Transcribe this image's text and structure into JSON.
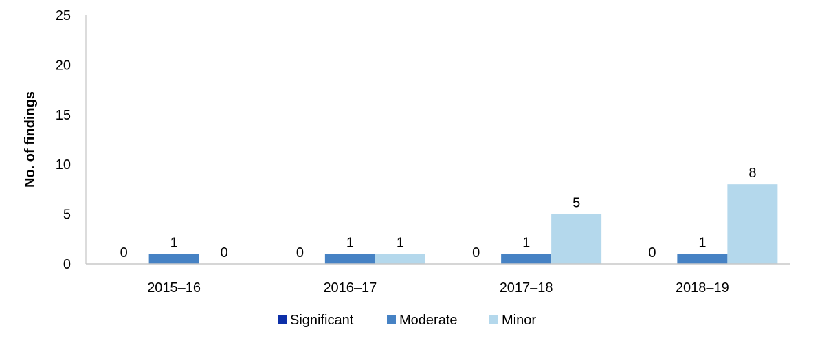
{
  "chart_data": {
    "type": "bar",
    "title": "",
    "xlabel": "",
    "ylabel": "No. of findings",
    "ylim": [
      0,
      25
    ],
    "yticks": [
      0,
      5,
      10,
      15,
      20,
      25
    ],
    "grid": false,
    "legend_position": "bottom",
    "categories": [
      "2015–16",
      "2016–17",
      "2017–18",
      "2018–19"
    ],
    "series": [
      {
        "name": "Significant",
        "color": "#0d2fa8",
        "values": [
          0,
          0,
          0,
          0
        ]
      },
      {
        "name": "Moderate",
        "color": "#4682c4",
        "values": [
          1,
          1,
          1,
          1
        ]
      },
      {
        "name": "Minor",
        "color": "#b4d8ec",
        "values": [
          0,
          1,
          5,
          8
        ]
      }
    ],
    "data_labels": true
  }
}
